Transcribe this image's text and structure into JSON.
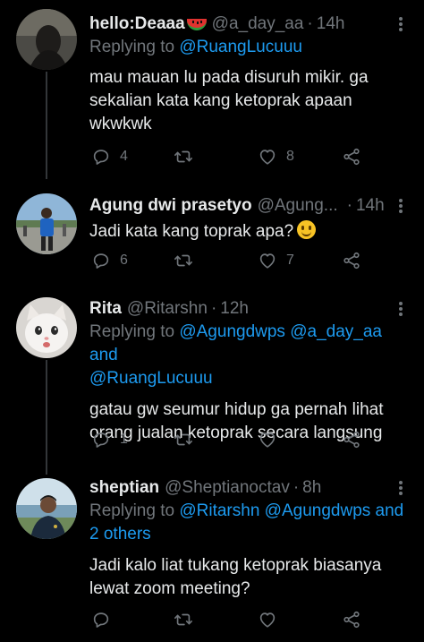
{
  "tweets": [
    {
      "name": "hello:Deaaa",
      "handle": "@a_day_aa",
      "time": "14h",
      "replying_label": "Replying to",
      "mentions": [
        "@RuangLucuuu"
      ],
      "lines": [
        "mau mauan lu pada disuruh mikir. ga",
        "sekalian kata kang ketoprak apaan",
        "wkwkwk"
      ],
      "replies": "4",
      "retweets": "",
      "likes": "8"
    },
    {
      "name": "Agung dwi prasetyo",
      "handle": "@Agung...",
      "time": "14h",
      "lines": [
        "Jadi kata kang toprak apa?"
      ],
      "replies": "6",
      "retweets": "",
      "likes": "7"
    },
    {
      "name": "Rita",
      "handle": "@Ritarshn",
      "time": "12h",
      "replying_label": "Replying to",
      "mentions": [
        "@Agungdwps",
        "@a_day_aa and",
        "@RuangLucuuu"
      ],
      "lines": [
        "gatau gw seumur hidup ga pernah lihat",
        "orang jualan ketoprak secara langsung"
      ],
      "replies": "1",
      "retweets": "",
      "likes": ""
    },
    {
      "name": "sheptian",
      "handle": "@Sheptianoctav",
      "time": "8h",
      "replying_label": "Replying to",
      "mentions": [
        "@Ritarshn",
        "@Agungdwps and",
        "2 others"
      ],
      "lines": [
        "Jadi kalo liat tukang ketoprak biasanya",
        "lewat zoom meeting?"
      ],
      "replies": "",
      "retweets": "",
      "likes": ""
    }
  ],
  "separator": "·",
  "colors": {
    "background": "#000000",
    "text": "#e7e9ea",
    "muted": "#71767b",
    "link": "#1d9bf0"
  },
  "icons": [
    "reply-icon",
    "retweet-icon",
    "like-icon",
    "share-icon",
    "more-icon",
    "watermelon-emoji",
    "smile-emoji"
  ]
}
